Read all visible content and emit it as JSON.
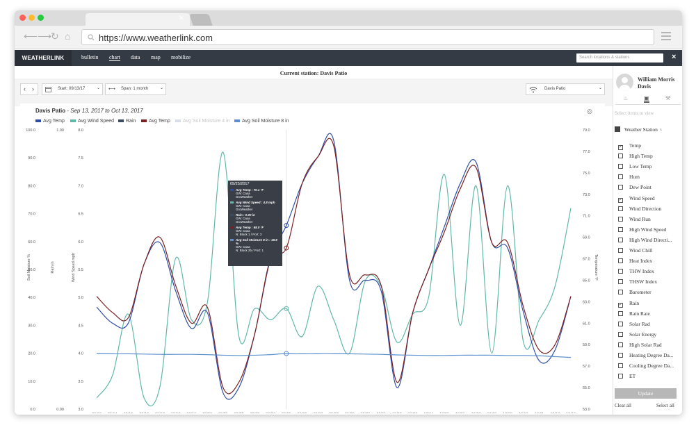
{
  "browser": {
    "url": "https://www.weatherlink.com",
    "tab_close": "×"
  },
  "app": {
    "logo": "WEATHERLINK",
    "nav": [
      "bulletin",
      "chart",
      "data",
      "map",
      "mobilize"
    ],
    "search_placeholder": "Search locations & stations",
    "close": "×",
    "current_station": "Current station: Davis Patio"
  },
  "toolbar": {
    "start_label": "Start: 09/13/17",
    "span_label": "Span: 1 month",
    "station_select": "Davis Patio"
  },
  "chart_header": {
    "station": "Davis Patio",
    "range": "Sep 13, 2017 to Oct 13, 2017"
  },
  "legend": [
    {
      "label": "Avg Temp",
      "color": "#2f4da8"
    },
    {
      "label": "Avg Wind Speed",
      "color": "#5fb8a8"
    },
    {
      "label": "Rain",
      "color": "#3d4a63"
    },
    {
      "label": "Avg Temp",
      "color": "#7a2020"
    },
    {
      "label": "Avg Soil Moisture 4 in",
      "color": "#c8d2e6"
    },
    {
      "label": "Avg Soil Moisture 8 in",
      "color": "#5b8fcf"
    }
  ],
  "tooltip": {
    "date": "09/25/2017",
    "entries": [
      {
        "lines": [
          "Avg Temp : 70.1 °F",
          "GW: Casa",
          "GroWeather"
        ],
        "color": "#2f4da8"
      },
      {
        "lines": [
          "Avg Wind Speed : 4.8 mph",
          "GW: Casa",
          "GroWeather"
        ],
        "color": "#5fb8a8"
      },
      {
        "lines": [
          "Rain : 0.00 in",
          "GW: Casa",
          "GroWeather"
        ],
        "color": "#3d4a63"
      },
      {
        "lines": [
          "Avg Temp : 68.0 °F",
          "GW: Casa",
          "N: Block 1 / Port: 2"
        ],
        "color": "#7a2020"
      },
      {
        "lines": [
          "Avg Soil Moisture 8 in : 19.9 %",
          "GW: Casa",
          "N: Block 2b / Port: 1"
        ],
        "color": "#5b8fcf"
      }
    ]
  },
  "chart_data": {
    "type": "line",
    "x": [
      "09/13",
      "09/14",
      "09/15",
      "09/16",
      "09/17",
      "09/18",
      "09/19",
      "09/20",
      "09/21",
      "09/22",
      "09/23",
      "09/24",
      "09/25",
      "09/26",
      "09/27",
      "09/28",
      "09/29",
      "09/30",
      "10/01",
      "10/02",
      "10/03",
      "10/04",
      "10/05",
      "10/06",
      "10/07",
      "10/08",
      "10/09",
      "10/10",
      "10/11",
      "10/12",
      "10/13"
    ],
    "axes": {
      "soil_moisture": {
        "label": "Soil Moisture %",
        "range": [
          0,
          100
        ],
        "ticks": [
          "0.0",
          "10.0",
          "20.0",
          "30.0",
          "40.0",
          "50.0",
          "60.0",
          "70.0",
          "80.0",
          "90.0",
          "100.0"
        ]
      },
      "rain": {
        "label": "Rain in",
        "ticks": [
          "0.00",
          "1.00"
        ]
      },
      "wind": {
        "label": "Wind Speed mph",
        "range": [
          3.0,
          8.0
        ],
        "ticks": [
          "3.0",
          "3.5",
          "4.0",
          "4.5",
          "5.0",
          "5.5",
          "6.0",
          "6.5",
          "7.0",
          "7.5",
          "8.0"
        ]
      },
      "temp": {
        "label": "Temperature °F",
        "range": [
          53.0,
          79.0
        ],
        "ticks": [
          "53.0",
          "55.0",
          "57.0",
          "59.0",
          "61.0",
          "63.0",
          "65.0",
          "67.0",
          "69.0",
          "71.0",
          "73.0",
          "75.0",
          "77.0",
          "79.0"
        ]
      }
    },
    "series": [
      {
        "name": "Avg Wind Speed",
        "axis": "wind",
        "color": "#5fb8a8",
        "values": [
          3.2,
          3.6,
          4.7,
          3.2,
          3.4,
          5.7,
          4.6,
          4.9,
          7.6,
          4.3,
          4.8,
          4.6,
          4.8,
          4.3,
          5.2,
          4.6,
          4.0,
          5.3,
          5.2,
          4.2,
          4.7,
          5.0,
          7.2,
          4.5,
          7.0,
          4.0,
          7.0,
          4.2,
          4.6,
          5.2,
          6.6
        ]
      },
      {
        "name": "Avg Temp",
        "axis": "temp",
        "color": "#2f4da8",
        "values": [
          62.5,
          61.0,
          61.0,
          66.5,
          68.5,
          64.0,
          60.5,
          62.0,
          54.5,
          55.0,
          60.0,
          67.0,
          70.1,
          74.0,
          76.5,
          78.0,
          65.0,
          65.0,
          64.0,
          55.0,
          62.0,
          66.0,
          70.0,
          74.0,
          76.0,
          68.5,
          68.0,
          62.0,
          57.5,
          58.5,
          63.5
        ]
      },
      {
        "name": "Avg Temp",
        "axis": "temp",
        "color": "#7a2020",
        "values": [
          63.5,
          62.0,
          61.5,
          66.5,
          69.0,
          64.5,
          61.0,
          62.5,
          55.0,
          55.5,
          60.0,
          67.0,
          68.0,
          74.0,
          76.5,
          77.5,
          65.5,
          65.5,
          64.5,
          55.5,
          62.0,
          66.0,
          69.5,
          73.5,
          75.5,
          68.5,
          68.5,
          62.5,
          58.5,
          59.0,
          63.5
        ]
      },
      {
        "name": "Avg Soil Moisture 8 in",
        "axis": "soil_moisture",
        "color": "#5b8fcf",
        "values": [
          20.0,
          19.8,
          19.8,
          19.7,
          19.6,
          19.6,
          19.6,
          19.5,
          19.3,
          19.2,
          19.3,
          19.5,
          19.9,
          19.8,
          19.9,
          19.9,
          19.8,
          19.7,
          19.6,
          19.4,
          19.3,
          19.2,
          19.2,
          19.3,
          19.3,
          19.3,
          19.2,
          19.2,
          19.1,
          18.8,
          18.5
        ]
      }
    ],
    "tooltip_index": 12
  },
  "sidebar": {
    "user_name": "William Morris Davis",
    "select_hint": "Select items to view",
    "group_label": "Weather Station",
    "items": [
      {
        "label": "Temp",
        "checked": true
      },
      {
        "label": "High Temp",
        "checked": false
      },
      {
        "label": "Low Temp",
        "checked": false
      },
      {
        "label": "Hum",
        "checked": false
      },
      {
        "label": "Dew Point",
        "checked": false
      },
      {
        "label": "Wind Speed",
        "checked": true
      },
      {
        "label": "Wind Direction",
        "checked": false
      },
      {
        "label": "Wind Run",
        "checked": false
      },
      {
        "label": "High Wind Speed",
        "checked": false
      },
      {
        "label": "High Wind Directi...",
        "checked": false
      },
      {
        "label": "Wind Chill",
        "checked": false
      },
      {
        "label": "Heat Index",
        "checked": false
      },
      {
        "label": "THW Index",
        "checked": false
      },
      {
        "label": "THSW Index",
        "checked": false
      },
      {
        "label": "Barometer",
        "checked": false
      },
      {
        "label": "Rain",
        "checked": true
      },
      {
        "label": "Rain Rate",
        "checked": false
      },
      {
        "label": "Solar Rad",
        "checked": false
      },
      {
        "label": "Solar Energy",
        "checked": false
      },
      {
        "label": "High Solar Rad",
        "checked": false
      },
      {
        "label": "Heating Degree Da...",
        "checked": false
      },
      {
        "label": "Cooling Degree Da...",
        "checked": false
      },
      {
        "label": "ET",
        "checked": false
      }
    ],
    "update_button": "Update",
    "clear_all": "Clear all",
    "select_all": "Select all"
  },
  "colors": {
    "appbar": "#353b44",
    "accent_teal": "#5fb8a8",
    "temp_blue": "#2f4da8",
    "temp_red": "#7a2020",
    "soil_blue": "#5b8fcf"
  }
}
